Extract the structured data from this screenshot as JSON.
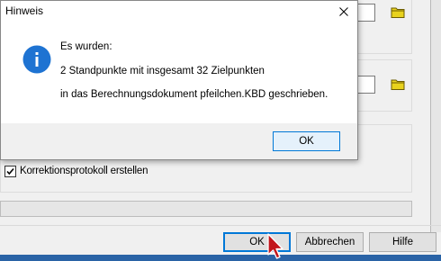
{
  "main_dialog": {
    "checkbox_label": "Korrektionsprotokoll erstellen",
    "checkbox_checked": true,
    "progress_fraction": 0.0,
    "buttons": {
      "ok": "OK",
      "cancel": "Abbrechen",
      "help": "Hilfe"
    },
    "icons": {
      "browse_1": "folder-icon",
      "browse_2": "folder-icon"
    }
  },
  "message_box": {
    "title": "Hinweis",
    "icon": "info-icon",
    "lines": [
      "Es wurden:",
      "2 Standpunkte mit insgesamt 32 Zielpunkten",
      "in das Berechnungsdokument pfeilchen.KBD geschrieben."
    ],
    "ok_label": "OK"
  },
  "colors": {
    "info_blue": "#1e73d2",
    "focus_border": "#0078d7",
    "cursor_red": "#c2151b"
  }
}
